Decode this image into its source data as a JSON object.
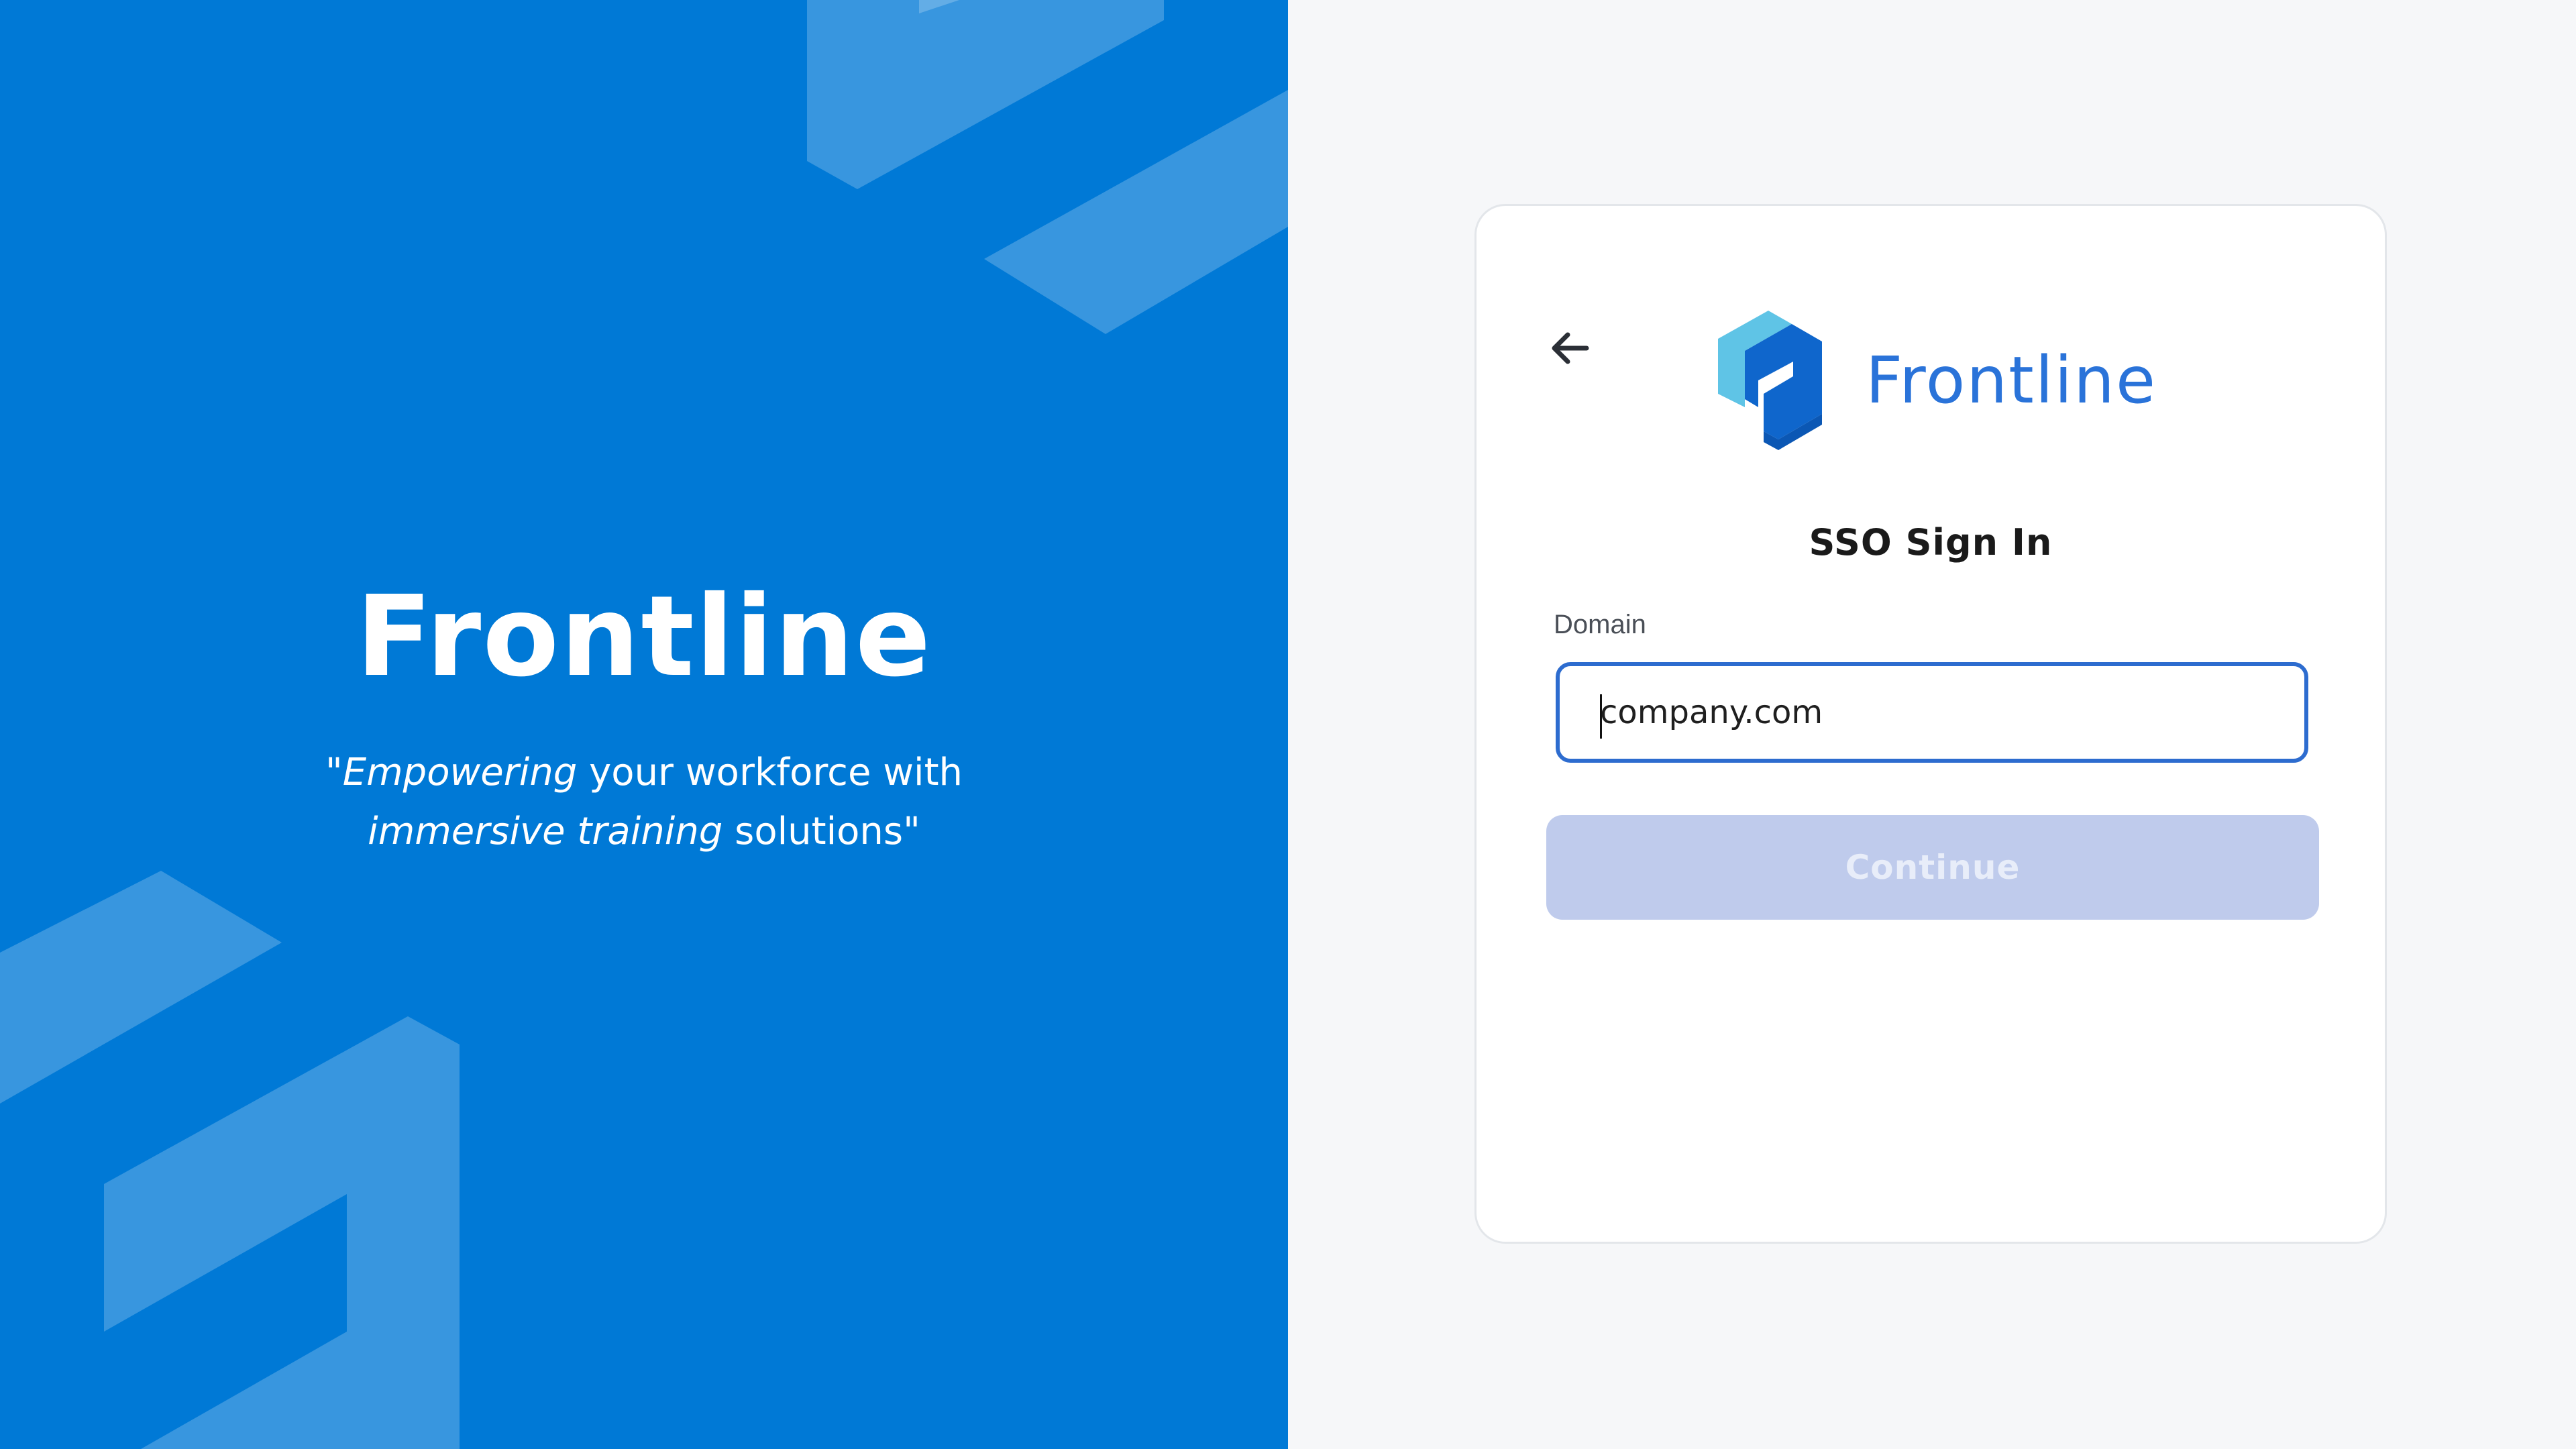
{
  "hero": {
    "title": "Frontline",
    "tagline": {
      "quote_open": "\"",
      "em1": "Empowering",
      "mid": " your workforce with",
      "em2": "immersive training",
      "end": " solutions\""
    }
  },
  "card": {
    "brand_name": "Frontline",
    "heading": "SSO Sign In",
    "domain_label": "Domain",
    "domain_placeholder": "company.com",
    "continue_label": "Continue",
    "back_icon": "arrow-left-icon"
  },
  "colors": {
    "left_bg": "#0079d6",
    "right_bg": "#f6f7f9",
    "brand_blue": "#2a73d9",
    "input_border": "#2d6ccf",
    "button_disabled_bg": "#bfcbec"
  }
}
